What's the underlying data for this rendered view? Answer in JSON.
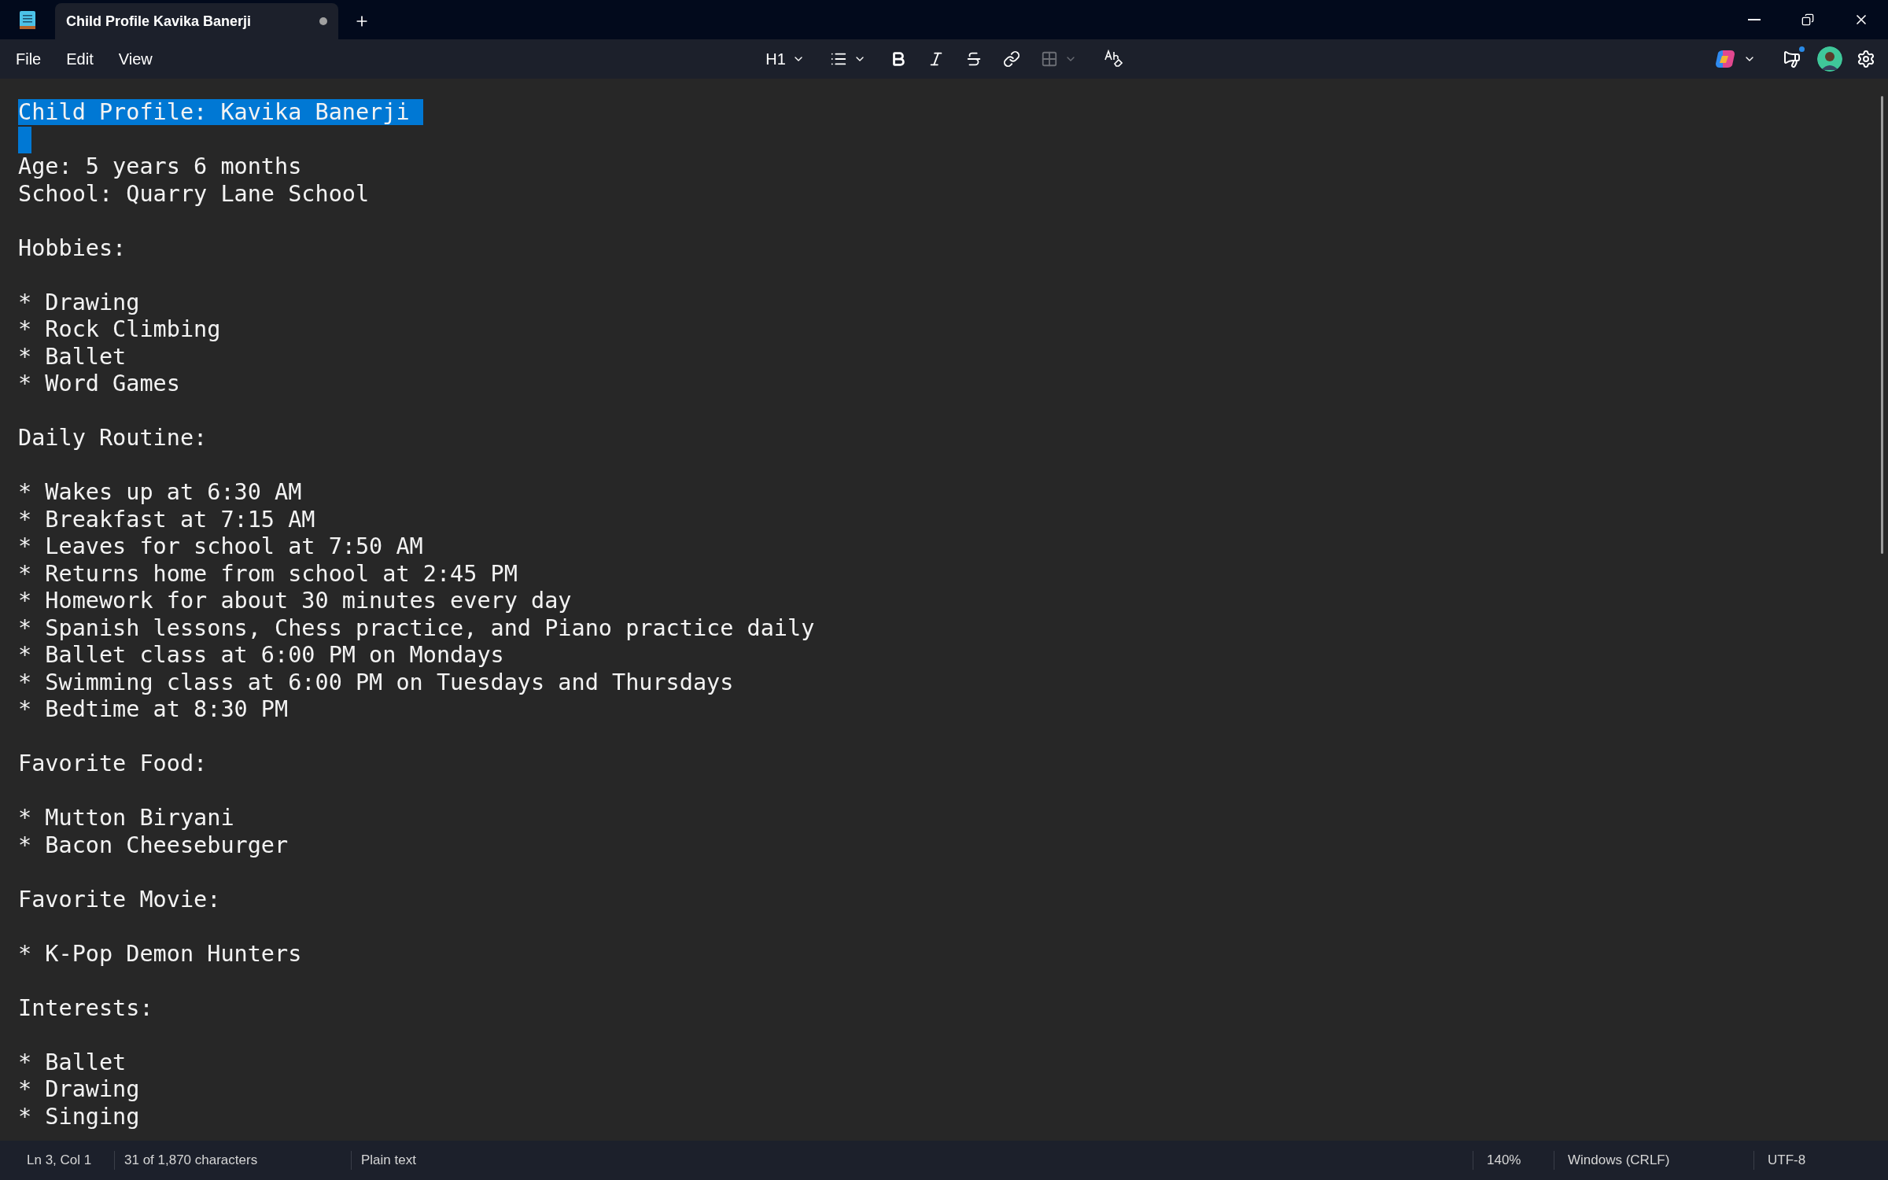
{
  "tab": {
    "title": "Child Profile Kavika Banerji",
    "unsaved": true
  },
  "menu": [
    "File",
    "Edit",
    "View"
  ],
  "toolbar": {
    "heading": "H1",
    "table_disabled": true,
    "announcement_unread": true
  },
  "document": {
    "title": "Child Profile: Kavika Banerji",
    "title_selected": true,
    "fields": [
      "Age: 5 years 6 months",
      "School: Quarry Lane School"
    ],
    "sections": [
      {
        "heading": "Hobbies:",
        "items": [
          "* Drawing",
          "* Rock Climbing",
          "* Ballet",
          "* Word Games"
        ]
      },
      {
        "heading": "Daily Routine:",
        "items": [
          "* Wakes up at 6:30 AM",
          "* Breakfast at 7:15 AM",
          "* Leaves for school at 7:50 AM",
          "* Returns home from school at 2:45 PM",
          "* Homework for about 30 minutes every day",
          "* Spanish lessons, Chess practice, and Piano practice daily",
          "* Ballet class at 6:00 PM on Mondays",
          "* Swimming class at 6:00 PM on Tuesdays and Thursdays",
          "* Bedtime at 8:30 PM"
        ]
      },
      {
        "heading": "Favorite Food:",
        "items": [
          "* Mutton Biryani",
          "* Bacon Cheeseburger"
        ]
      },
      {
        "heading": "Favorite Movie:",
        "items": [
          "* K-Pop Demon Hunters"
        ]
      },
      {
        "heading": "Interests:",
        "items": [
          "* Ballet",
          "* Drawing",
          "* Singing"
        ]
      }
    ]
  },
  "status_bar": {
    "position": "Ln 3, Col 1",
    "count": "31 of 1,870 characters",
    "format": "Plain text",
    "zoom": "140%",
    "line_ending": "Windows (CRLF)",
    "encoding": "UTF-8"
  }
}
